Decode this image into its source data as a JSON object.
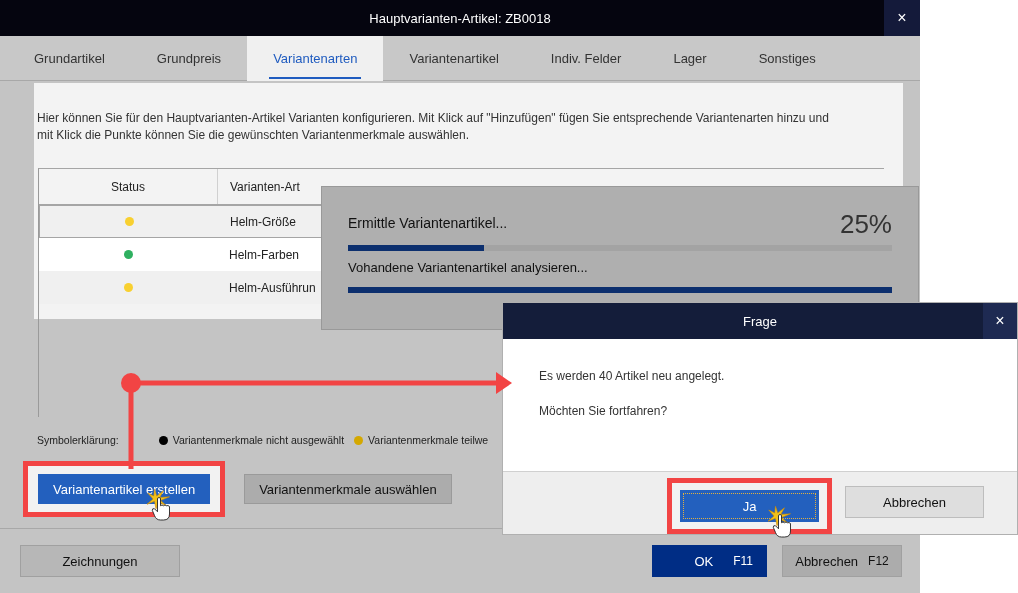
{
  "window": {
    "title": "Hauptvarianten-Artikel: ZB0018",
    "close": "×"
  },
  "tabs": [
    {
      "label": "Grundartikel",
      "selected": false
    },
    {
      "label": "Grundpreis",
      "selected": false
    },
    {
      "label": "Variantenarten",
      "selected": true
    },
    {
      "label": "Variantenartikel",
      "selected": false
    },
    {
      "label": "Indiv. Felder",
      "selected": false
    },
    {
      "label": "Lager",
      "selected": false
    },
    {
      "label": "Sonstiges",
      "selected": false
    }
  ],
  "description": "Hier können Sie für den Hauptvarianten-Artikel Varianten konfigurieren. Mit Klick auf \"Hinzufügen\" fügen Sie entsprechende Variantenarten hinzu und mit Klick die Punkte können Sie die gewünschten Variantenmerkmale auswählen.",
  "table": {
    "columns": [
      "Status",
      "Varianten-Art"
    ],
    "rows": [
      {
        "color": "#f8d030",
        "name": "Helm-Größe",
        "selected": true
      },
      {
        "color": "#2fb060",
        "name": "Helm-Farben",
        "selected": false
      },
      {
        "color": "#f8d030",
        "name": "Helm-Ausführun",
        "selected": false
      }
    ]
  },
  "legend": {
    "label": "Symbolerklärung:",
    "items": [
      {
        "color": "#000000",
        "text": "Variantenmerkmale nicht ausgewählt"
      },
      {
        "color": "#d4a800",
        "text": "Variantenmerkmale teilwe"
      }
    ]
  },
  "actions": [
    {
      "label": "Variantenartikel erstellen",
      "kind": "primary",
      "highlighted": true,
      "clicked": true
    },
    {
      "label": "Variantenmerkmale auswählen",
      "kind": "secondary",
      "highlighted": false,
      "clicked": false
    }
  ],
  "footer": {
    "left_buttons": [
      {
        "label": "Zeichnungen"
      }
    ],
    "right_buttons": [
      {
        "label": "OK",
        "shortcut": "F11",
        "kind": "primary"
      },
      {
        "label": "Abbrechen",
        "shortcut": "F12",
        "kind": "secondary"
      }
    ]
  },
  "progress": {
    "bars": [
      {
        "label": "Ermittle Variantenartikel...",
        "reading": "25%",
        "level": 0.25
      },
      {
        "label": "Vohandene Variantenartikel analysieren...",
        "level": 1
      }
    ]
  },
  "dialog": {
    "title": "Frage",
    "close": "×",
    "messages": [
      "Es werden 40 Artikel neu angelegt.",
      "Möchten Sie fortfahren?"
    ],
    "buttons": [
      {
        "label": "Ja",
        "kind": "primary",
        "highlighted": true,
        "clicked": true
      },
      {
        "label": "Abbrechen",
        "kind": "secondary",
        "highlighted": false,
        "clicked": false
      }
    ]
  }
}
